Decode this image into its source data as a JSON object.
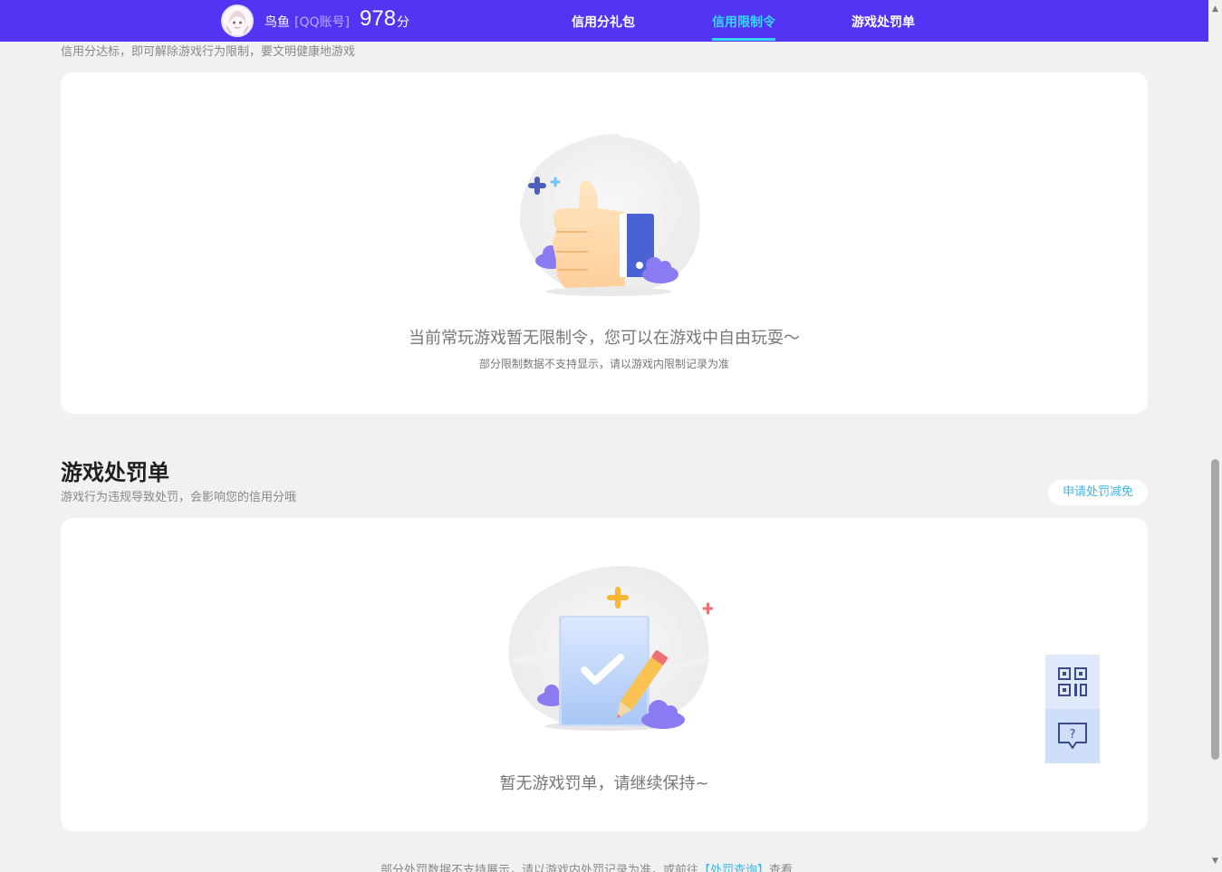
{
  "header": {
    "username": "鸟鱼",
    "account_type": "[QQ账号]",
    "score": "978",
    "score_unit": "分",
    "nav": [
      {
        "label": "信用分礼包",
        "active": false
      },
      {
        "label": "信用限制令",
        "active": true
      },
      {
        "label": "游戏处罚单",
        "active": false
      }
    ]
  },
  "restriction": {
    "subtitle": "信用分达标，即可解除游戏行为限制，要文明健康地游戏",
    "empty_title": "当前常玩游戏暂无限制令，您可以在游戏中自由玩耍～",
    "empty_note": "部分限制数据不支持显示，请以游戏内限制记录为准",
    "icon": "thumbs-up-illustration"
  },
  "penalty": {
    "title": "游戏处罚单",
    "subtitle": "游戏行为违规导致处罚，会影响您的信用分哦",
    "appeal_label": "申请处罚减免",
    "empty_title": "暂无游戏罚单，请继续保持~",
    "icon": "checklist-pencil-illustration"
  },
  "footer": {
    "note_prefix": "部分处罚数据不支持展示，请以游戏内处罚记录为准，或前往",
    "link_label": "【处罚查询】",
    "note_suffix": "查看"
  },
  "float_tools": {
    "qr_icon": "qr-code-icon",
    "help_icon": "help-chat-icon"
  },
  "colors": {
    "header_bg": "#5334f5",
    "nav_active": "#35d7ff",
    "link": "#3fb5e8"
  }
}
